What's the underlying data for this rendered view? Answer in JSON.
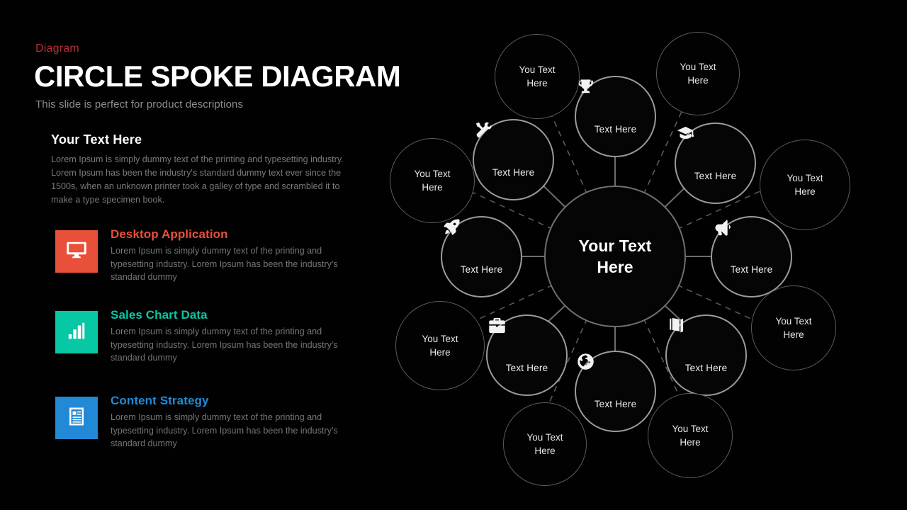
{
  "kicker": "Diagram",
  "title": "CIRCLE SPOKE DIAGRAM",
  "subtitle": "This slide is perfect for product descriptions",
  "intro": {
    "heading": "Your  Text Here",
    "body": "Lorem Ipsum is simply dummy text of the printing and typesetting industry. Lorem Ipsum has been the industry's standard dummy text ever since the 1500s, when an unknown printer took a galley of type and scrambled it to make a type specimen book."
  },
  "features": [
    {
      "title": "Desktop Application",
      "body": "Lorem Ipsum is simply dummy text of the printing and typesetting industry. Lorem Ipsum has been the industry's standard dummy",
      "color": "#E8503A",
      "icon": "monitor-icon"
    },
    {
      "title": "Sales Chart Data",
      "body": "Lorem Ipsum is simply dummy text of the printing and typesetting industry. Lorem Ipsum has been the industry's standard dummy",
      "color": "#08C7A5",
      "icon": "bar-chart-icon"
    },
    {
      "title": "Content Strategy",
      "body": "Lorem Ipsum is simply dummy text of the printing and typesetting industry. Lorem Ipsum has been the industry's standard dummy",
      "color": "#2189D6",
      "icon": "document-icon"
    }
  ],
  "diagram": {
    "hub": {
      "label_line1": "Your Text",
      "label_line2": "Here"
    },
    "inner_nodes": [
      {
        "label": "Text Here",
        "icon": "trophy-icon"
      },
      {
        "label": "Text Here",
        "icon": "graduation-cap-icon"
      },
      {
        "label": "Text Here",
        "icon": "megaphone-icon"
      },
      {
        "label": "Text Here",
        "icon": "book-icon"
      },
      {
        "label": "Text Here",
        "icon": "globe-icon"
      },
      {
        "label": "Text Here",
        "icon": "briefcase-icon"
      },
      {
        "label": "Text Here",
        "icon": "rocket-icon"
      },
      {
        "label": "Text Here",
        "icon": "tools-icon"
      }
    ],
    "outer_nodes": [
      {
        "label_line1": "You Text",
        "label_line2": "Here"
      },
      {
        "label_line1": "You Text",
        "label_line2": "Here"
      },
      {
        "label_line1": "You Text",
        "label_line2": "Here"
      },
      {
        "label_line1": "You Text",
        "label_line2": "Here"
      },
      {
        "label_line1": "You Text",
        "label_line2": "Here"
      },
      {
        "label_line1": "You Text",
        "label_line2": "Here"
      },
      {
        "label_line1": "You Text",
        "label_line2": "Here"
      },
      {
        "label_line1": "You Text",
        "label_line2": "Here"
      }
    ]
  },
  "colors": {
    "background": "#000000",
    "kicker": "#b5303a",
    "title": "#ffffff",
    "body_text": "#7a7a7a",
    "ring_stroke": "#9b9b9b",
    "outer_stroke": "#5c5c5c"
  }
}
